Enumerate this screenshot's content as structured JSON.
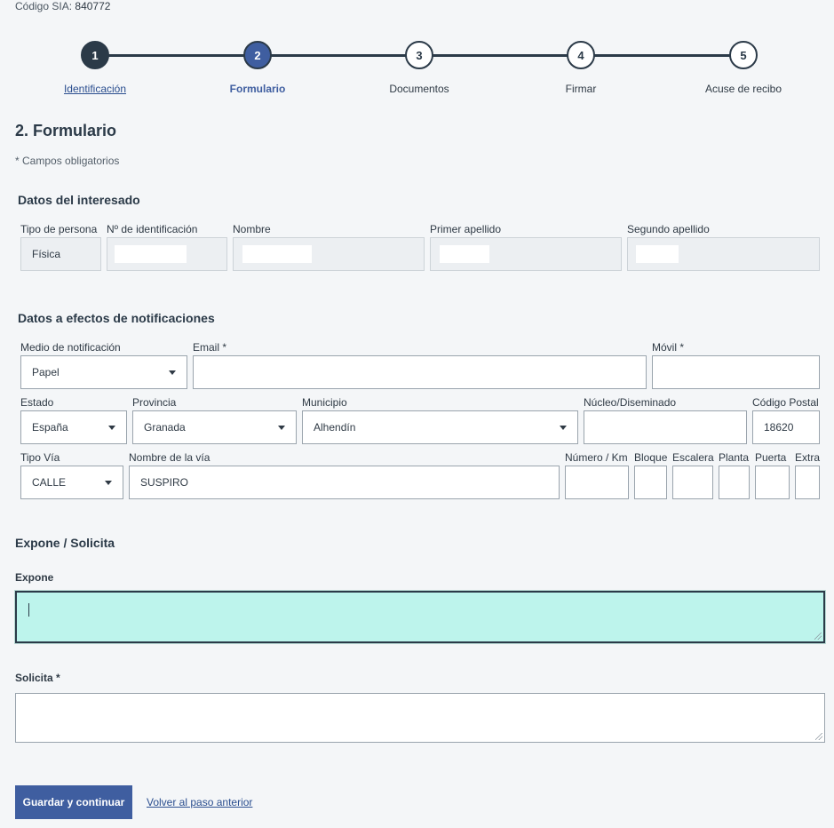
{
  "header": {
    "sia_label": "Código SIA:",
    "sia_value": "840772"
  },
  "stepper": {
    "steps": [
      {
        "number": "1",
        "label": "Identificación"
      },
      {
        "number": "2",
        "label": "Formulario"
      },
      {
        "number": "3",
        "label": "Documentos"
      },
      {
        "number": "4",
        "label": "Firmar"
      },
      {
        "number": "5",
        "label": "Acuse de recibo"
      }
    ]
  },
  "page": {
    "title": "2. Formulario",
    "required_note": "* Campos obligatorios"
  },
  "interesado": {
    "title": "Datos del interesado",
    "tipo_persona": {
      "label": "Tipo de persona",
      "value": "Física"
    },
    "identificacion": {
      "label": "Nº de identificación",
      "value": ""
    },
    "nombre": {
      "label": "Nombre",
      "value": ""
    },
    "primer_apellido": {
      "label": "Primer apellido",
      "value": ""
    },
    "segundo_apellido": {
      "label": "Segundo apellido",
      "value": ""
    }
  },
  "notificaciones": {
    "title": "Datos a efectos de notificaciones",
    "medio": {
      "label": "Medio de notificación",
      "value": "Papel"
    },
    "email": {
      "label": "Email *",
      "value": ""
    },
    "movil": {
      "label": "Móvil *",
      "value": ""
    },
    "estado": {
      "label": "Estado",
      "value": "España"
    },
    "provincia": {
      "label": "Provincia",
      "value": "Granada"
    },
    "municipio": {
      "label": "Municipio",
      "value": "Alhendín"
    },
    "nucleo": {
      "label": "Núcleo/Diseminado",
      "value": ""
    },
    "codigo_postal": {
      "label": "Código Postal",
      "value": "18620"
    },
    "tipo_via": {
      "label": "Tipo Vía",
      "value": "CALLE"
    },
    "nombre_via": {
      "label": "Nombre de la vía",
      "value": "SUSPIRO"
    },
    "numero": {
      "label": "Número / Km",
      "value": ""
    },
    "bloque": {
      "label": "Bloque",
      "value": ""
    },
    "escalera": {
      "label": "Escalera",
      "value": ""
    },
    "planta": {
      "label": "Planta",
      "value": ""
    },
    "puerta": {
      "label": "Puerta",
      "value": ""
    },
    "extra": {
      "label": "Extra",
      "value": ""
    }
  },
  "expone_solicita": {
    "title": "Expone / Solicita",
    "expone_label": "Expone",
    "solicita_label": "Solicita *"
  },
  "actions": {
    "save_label": "Guardar y continuar",
    "back_label": "Volver al paso anterior"
  },
  "colors": {
    "primary": "#3f5ea0",
    "dark": "#2b3a48",
    "focus_bg": "#bdf4ec",
    "background": "#f4f6f8"
  }
}
